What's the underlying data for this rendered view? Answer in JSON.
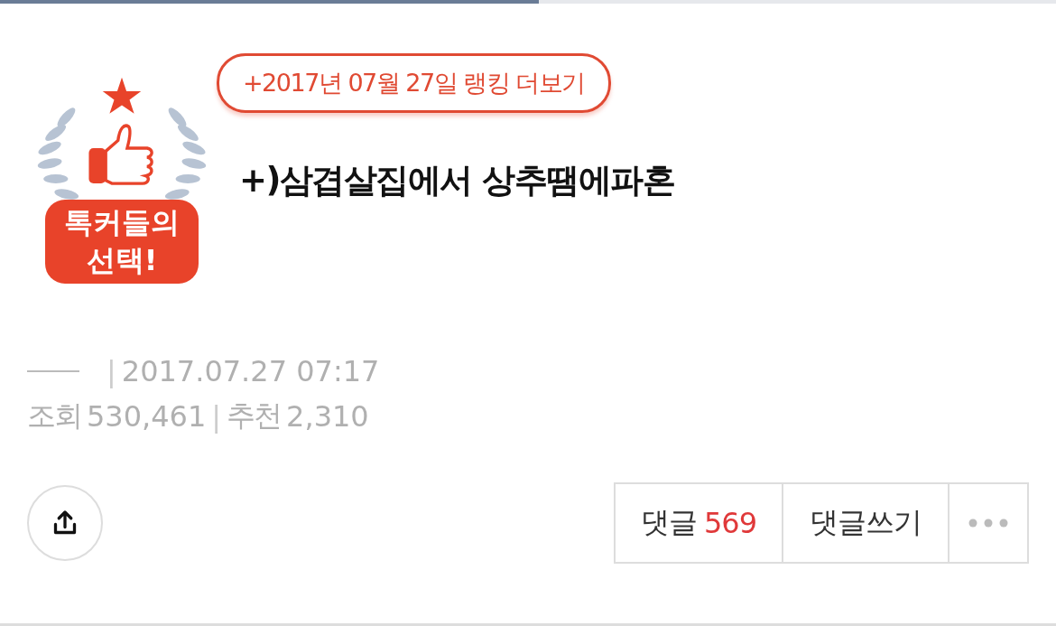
{
  "reading_progress": {
    "level": 0.51
  },
  "badge": {
    "label": "톡커들의 선택!"
  },
  "ranking_link": "+2017년 07월 27일 랭킹 더보기",
  "title": "+)삼겹살집에서 상추땜에파혼",
  "meta": {
    "separator": "|",
    "datetime": "2017.07.27 07:17",
    "views_label": "조회",
    "views": "530,461",
    "recommend_label": "추천",
    "recommends": "2,310"
  },
  "actions": {
    "comments_label": "댓글",
    "comments_count": "569",
    "write_comment": "댓글쓰기"
  }
}
